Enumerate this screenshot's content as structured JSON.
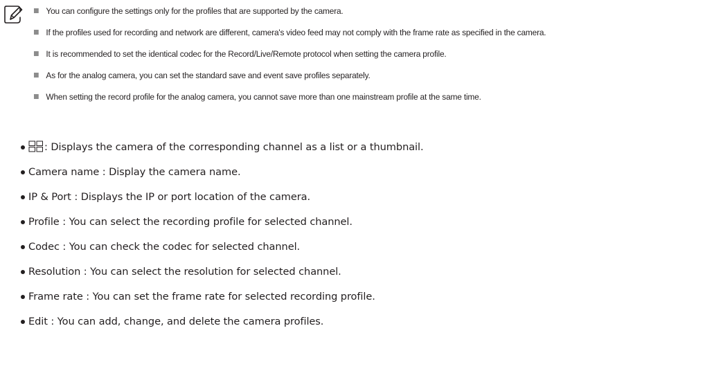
{
  "note_icon": "note-pencil-icon",
  "notes": [
    "You can configure the settings only for the profiles that are supported by the camera.",
    "If the profiles used for recording and network are different, camera's video feed may not comply with the frame rate as specified in the camera.",
    "It is recommended to set the identical codec for the Record/Live/Remote protocol when setting the camera profile.",
    "As for the analog camera, you can set the standard save and event save profiles separately.",
    "When setting the record profile for the analog camera, you cannot save more than one mainstream profile at the same time."
  ],
  "bullets": {
    "view_toggle_icon": "grid-view-icon",
    "view_toggle_text": ": Displays the camera of the corresponding channel as a list or a thumbnail.",
    "camera_name": "Camera name : Display the camera name.",
    "ip_port": "IP & Port : Displays the IP or port location of the camera.",
    "profile": "Profile : You can select the recording profile for selected channel.",
    "codec": "Codec : You can check the codec for selected channel.",
    "resolution": "Resolution : You can select the resolution for selected channel.",
    "frame_rate": "Frame rate : You can set the frame rate for selected recording profile.",
    "edit": "Edit : You can add, change, and delete the camera profiles."
  }
}
